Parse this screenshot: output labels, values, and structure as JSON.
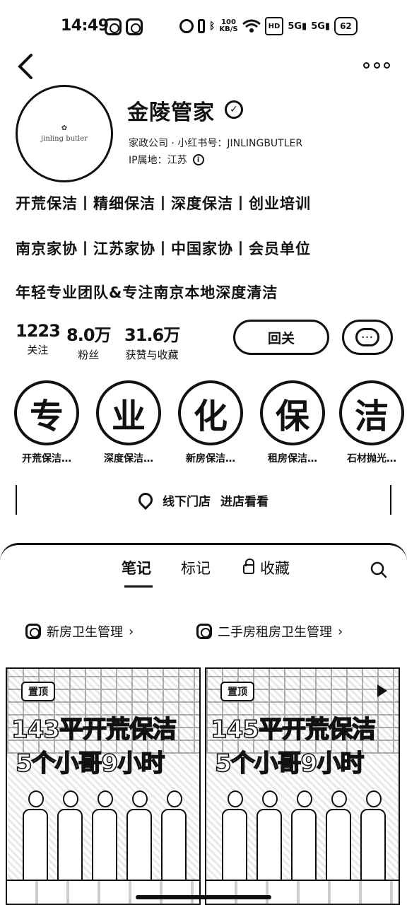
{
  "status": {
    "time": "14:49",
    "speed_top": "100",
    "speed_bottom": "KB/S",
    "hd": "HD",
    "signal1": "5G",
    "signal2": "5G",
    "battery": "62"
  },
  "profile": {
    "name": "金陵管家",
    "subtitle": "家政公司 · 小红书号：JINLINGBUTLER",
    "ip_label": "IP属地：江苏",
    "avatar_text": "jinling butler"
  },
  "bio": [
    "开荒保洁丨精细保洁丨深度保洁丨创业培训",
    "南京家协丨江苏家协丨中国家协丨会员单位",
    "年轻专业团队&专注南京本地深度清洁"
  ],
  "stats": [
    {
      "value": "1223",
      "label": "关注"
    },
    {
      "value": "8.0万",
      "label": "粉丝"
    },
    {
      "value": "31.6万",
      "label": "获赞与收藏"
    }
  ],
  "actions": {
    "follow_label": "回关",
    "message_glyph": "•••"
  },
  "highlights": [
    {
      "glyph": "专",
      "label": "开荒保洁…"
    },
    {
      "glyph": "业",
      "label": "深度保洁…"
    },
    {
      "glyph": "化",
      "label": "新房保洁…"
    },
    {
      "glyph": "保",
      "label": "租房保洁…"
    },
    {
      "glyph": "洁",
      "label": "石材抛光…"
    }
  ],
  "store": {
    "label": "线下门店",
    "action": "进店看看"
  },
  "tabs": [
    {
      "label": "笔记",
      "active": true
    },
    {
      "label": "标记",
      "active": false
    },
    {
      "label": "收藏",
      "active": false
    }
  ],
  "collections": [
    {
      "label": "新房卫生管理"
    },
    {
      "label": "二手房租房卫生管理"
    }
  ],
  "cards": [
    {
      "badge": "置顶",
      "title_line1": "143平开荒保洁",
      "title_line2": "5个小哥9小时"
    },
    {
      "badge": "置顶",
      "title_line1": "145平开荒保洁",
      "title_line2": "5个小哥9小时"
    }
  ]
}
